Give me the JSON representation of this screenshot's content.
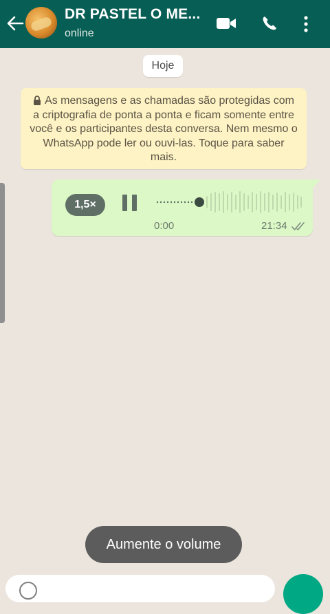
{
  "header": {
    "title": "DR PASTEL O ME...",
    "status": "online",
    "icons": [
      "arrow-left",
      "video-camera",
      "phone",
      "more-vertical"
    ]
  },
  "chat": {
    "date_chip": "Hoje",
    "encryption_notice": "As mensagens e as chamadas são protegidas com a criptografia de ponta a ponta e ficam somente entre você e os participantes desta conversa. Nem mesmo o WhatsApp pode ler ou ouvi-las. Toque para saber mais.",
    "voice_message": {
      "speed": "1,5×",
      "duration": "0:00",
      "time": "21:34",
      "read_status": "double-check"
    }
  },
  "toast": "Aumente o volume",
  "colors": {
    "header": "#075e54",
    "bubble_out": "#dcf8c6",
    "notice_bg": "#fdf3c4",
    "send_button": "#00a884"
  }
}
